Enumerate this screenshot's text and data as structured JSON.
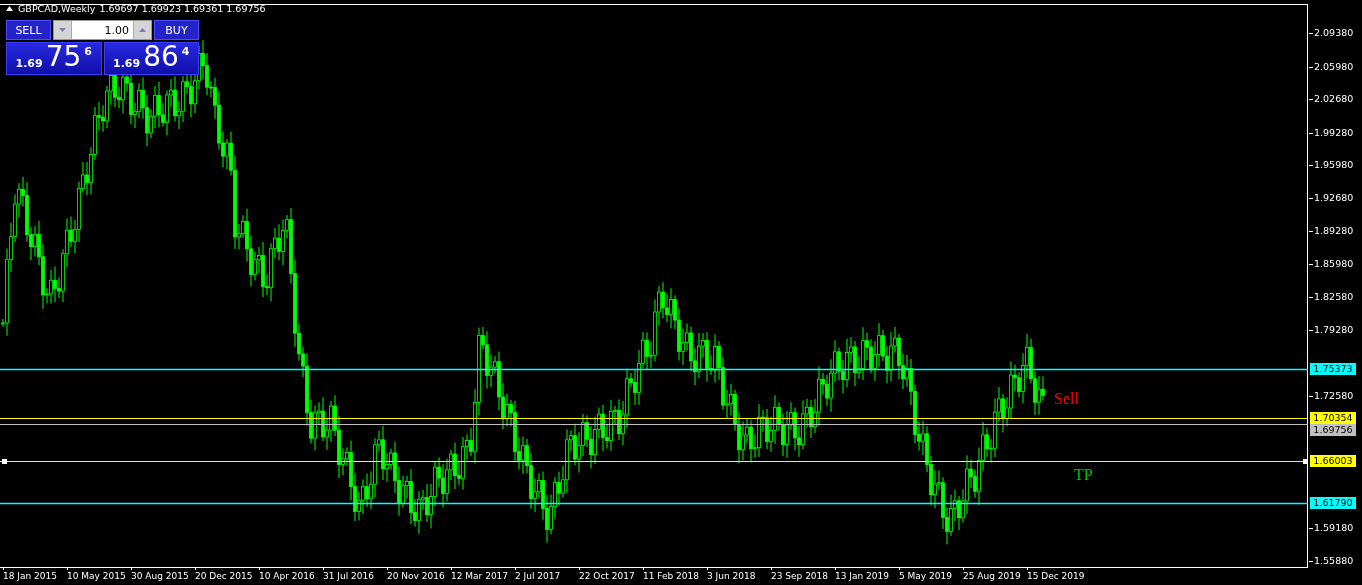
{
  "chart_header": {
    "symbol": "GBPCAD,Weekly",
    "ohlc": "1.69697 1.69923 1.69361 1.69756"
  },
  "trade_panel": {
    "sell_label": "SELL",
    "buy_label": "BUY",
    "lot": "1.00",
    "sell_price": {
      "prefix": "1.69",
      "big": "75",
      "sup": "6"
    },
    "buy_price": {
      "prefix": "1.69",
      "big": "86",
      "sup": "4"
    }
  },
  "price_axis": [
    "2.09380",
    "2.05980",
    "2.02680",
    "1.99280",
    "1.95980",
    "1.92680",
    "1.89280",
    "1.85980",
    "1.82580",
    "1.79280",
    "1.72580",
    "1.59180",
    "1.55880"
  ],
  "price_lines": [
    {
      "label": "1.75373",
      "color": "#00ffff",
      "selected": false
    },
    {
      "label": "1.70354",
      "color": "#ffff00",
      "selected": false
    },
    {
      "label": "1.69756",
      "color": "#c0c0c0",
      "selected": false
    },
    {
      "label": "1.66003",
      "color": "#ffff00",
      "selected": true
    },
    {
      "label": "1.61790",
      "color": "#00ffff",
      "selected": false
    }
  ],
  "annotations": [
    {
      "text": "Sell",
      "color": "#ff0000"
    },
    {
      "text": "TP",
      "color": "#00c800"
    }
  ],
  "time_axis": [
    "18 Jan 2015",
    "10 May 2015",
    "30 Aug 2015",
    "20 Dec 2015",
    "10 Apr 2016",
    "31 Jul 2016",
    "20 Nov 2016",
    "12 Mar 2017",
    "2 Jul 2017",
    "22 Oct 2017",
    "11 Feb 2018",
    "3 Jun 2018",
    "23 Sep 2018",
    "13 Jan 2019",
    "5 May 2019",
    "25 Aug 2019",
    "15 Dec 2019"
  ]
}
